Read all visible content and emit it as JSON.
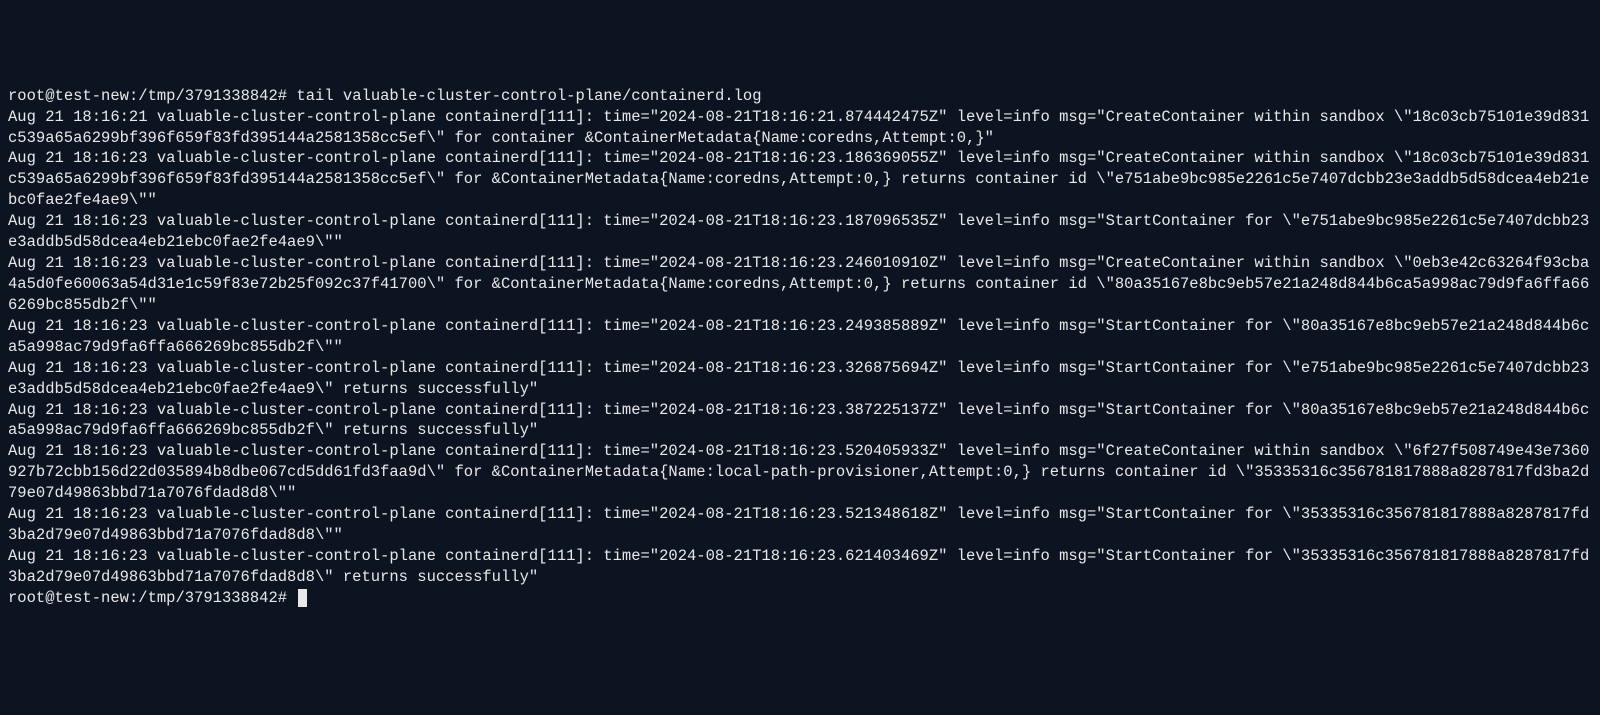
{
  "prompt": {
    "user": "root",
    "host": "test-new",
    "cwd": "/tmp/3791338842",
    "separator": "#",
    "command": "tail valuable-cluster-control-plane/containerd.log"
  },
  "log_lines": [
    "Aug 21 18:16:21 valuable-cluster-control-plane containerd[111]: time=\"2024-08-21T18:16:21.874442475Z\" level=info msg=\"CreateContainer within sandbox \\\"18c03cb75101e39d831c539a65a6299bf396f659f83fd395144a2581358cc5ef\\\" for container &ContainerMetadata{Name:coredns,Attempt:0,}\"",
    "Aug 21 18:16:23 valuable-cluster-control-plane containerd[111]: time=\"2024-08-21T18:16:23.186369055Z\" level=info msg=\"CreateContainer within sandbox \\\"18c03cb75101e39d831c539a65a6299bf396f659f83fd395144a2581358cc5ef\\\" for &ContainerMetadata{Name:coredns,Attempt:0,} returns container id \\\"e751abe9bc985e2261c5e7407dcbb23e3addb5d58dcea4eb21ebc0fae2fe4ae9\\\"\"",
    "Aug 21 18:16:23 valuable-cluster-control-plane containerd[111]: time=\"2024-08-21T18:16:23.187096535Z\" level=info msg=\"StartContainer for \\\"e751abe9bc985e2261c5e7407dcbb23e3addb5d58dcea4eb21ebc0fae2fe4ae9\\\"\"",
    "Aug 21 18:16:23 valuable-cluster-control-plane containerd[111]: time=\"2024-08-21T18:16:23.246010910Z\" level=info msg=\"CreateContainer within sandbox \\\"0eb3e42c63264f93cba4a5d0fe60063a54d31e1c59f83e72b25f092c37f41700\\\" for &ContainerMetadata{Name:coredns,Attempt:0,} returns container id \\\"80a35167e8bc9eb57e21a248d844b6ca5a998ac79d9fa6ffa666269bc855db2f\\\"\"",
    "Aug 21 18:16:23 valuable-cluster-control-plane containerd[111]: time=\"2024-08-21T18:16:23.249385889Z\" level=info msg=\"StartContainer for \\\"80a35167e8bc9eb57e21a248d844b6ca5a998ac79d9fa6ffa666269bc855db2f\\\"\"",
    "Aug 21 18:16:23 valuable-cluster-control-plane containerd[111]: time=\"2024-08-21T18:16:23.326875694Z\" level=info msg=\"StartContainer for \\\"e751abe9bc985e2261c5e7407dcbb23e3addb5d58dcea4eb21ebc0fae2fe4ae9\\\" returns successfully\"",
    "Aug 21 18:16:23 valuable-cluster-control-plane containerd[111]: time=\"2024-08-21T18:16:23.387225137Z\" level=info msg=\"StartContainer for \\\"80a35167e8bc9eb57e21a248d844b6ca5a998ac79d9fa6ffa666269bc855db2f\\\" returns successfully\"",
    "Aug 21 18:16:23 valuable-cluster-control-plane containerd[111]: time=\"2024-08-21T18:16:23.520405933Z\" level=info msg=\"CreateContainer within sandbox \\\"6f27f508749e43e7360927b72cbb156d22d035894b8dbe067cd5dd61fd3faa9d\\\" for &ContainerMetadata{Name:local-path-provisioner,Attempt:0,} returns container id \\\"35335316c356781817888a8287817fd3ba2d79e07d49863bbd71a7076fdad8d8\\\"\"",
    "Aug 21 18:16:23 valuable-cluster-control-plane containerd[111]: time=\"2024-08-21T18:16:23.521348618Z\" level=info msg=\"StartContainer for \\\"35335316c356781817888a8287817fd3ba2d79e07d49863bbd71a7076fdad8d8\\\"\"",
    "Aug 21 18:16:23 valuable-cluster-control-plane containerd[111]: time=\"2024-08-21T18:16:23.621403469Z\" level=info msg=\"StartContainer for \\\"35335316c356781817888a8287817fd3ba2d79e07d49863bbd71a7076fdad8d8\\\" returns successfully\""
  ]
}
